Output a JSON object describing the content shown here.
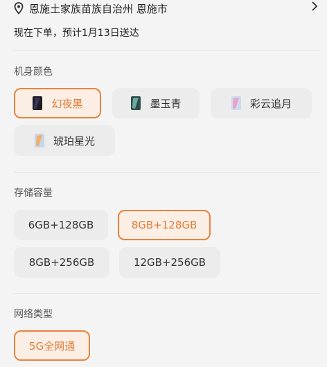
{
  "address": {
    "text": "恩施土家族苗族自治州 恩施市"
  },
  "delivery": {
    "text": "现在下单，预计1月13日送达"
  },
  "color_section": {
    "title": "机身颜色",
    "options": [
      {
        "label": "幻夜黑",
        "selected": true
      },
      {
        "label": "墨玉青",
        "selected": false
      },
      {
        "label": "彩云追月",
        "selected": false
      },
      {
        "label": "琥珀星光",
        "selected": false
      }
    ]
  },
  "storage_section": {
    "title": "存储容量",
    "options": [
      {
        "label": "6GB+128GB",
        "selected": false
      },
      {
        "label": "8GB+128GB",
        "selected": true
      },
      {
        "label": "8GB+256GB",
        "selected": false
      },
      {
        "label": "12GB+256GB",
        "selected": false
      }
    ]
  },
  "network_section": {
    "title": "网络类型",
    "options": [
      {
        "label": "5G全网通",
        "selected": true
      }
    ]
  },
  "colors": {
    "accent": "#e8833e",
    "selected_bg": "#fbeee5",
    "option_bg": "#ececec"
  }
}
